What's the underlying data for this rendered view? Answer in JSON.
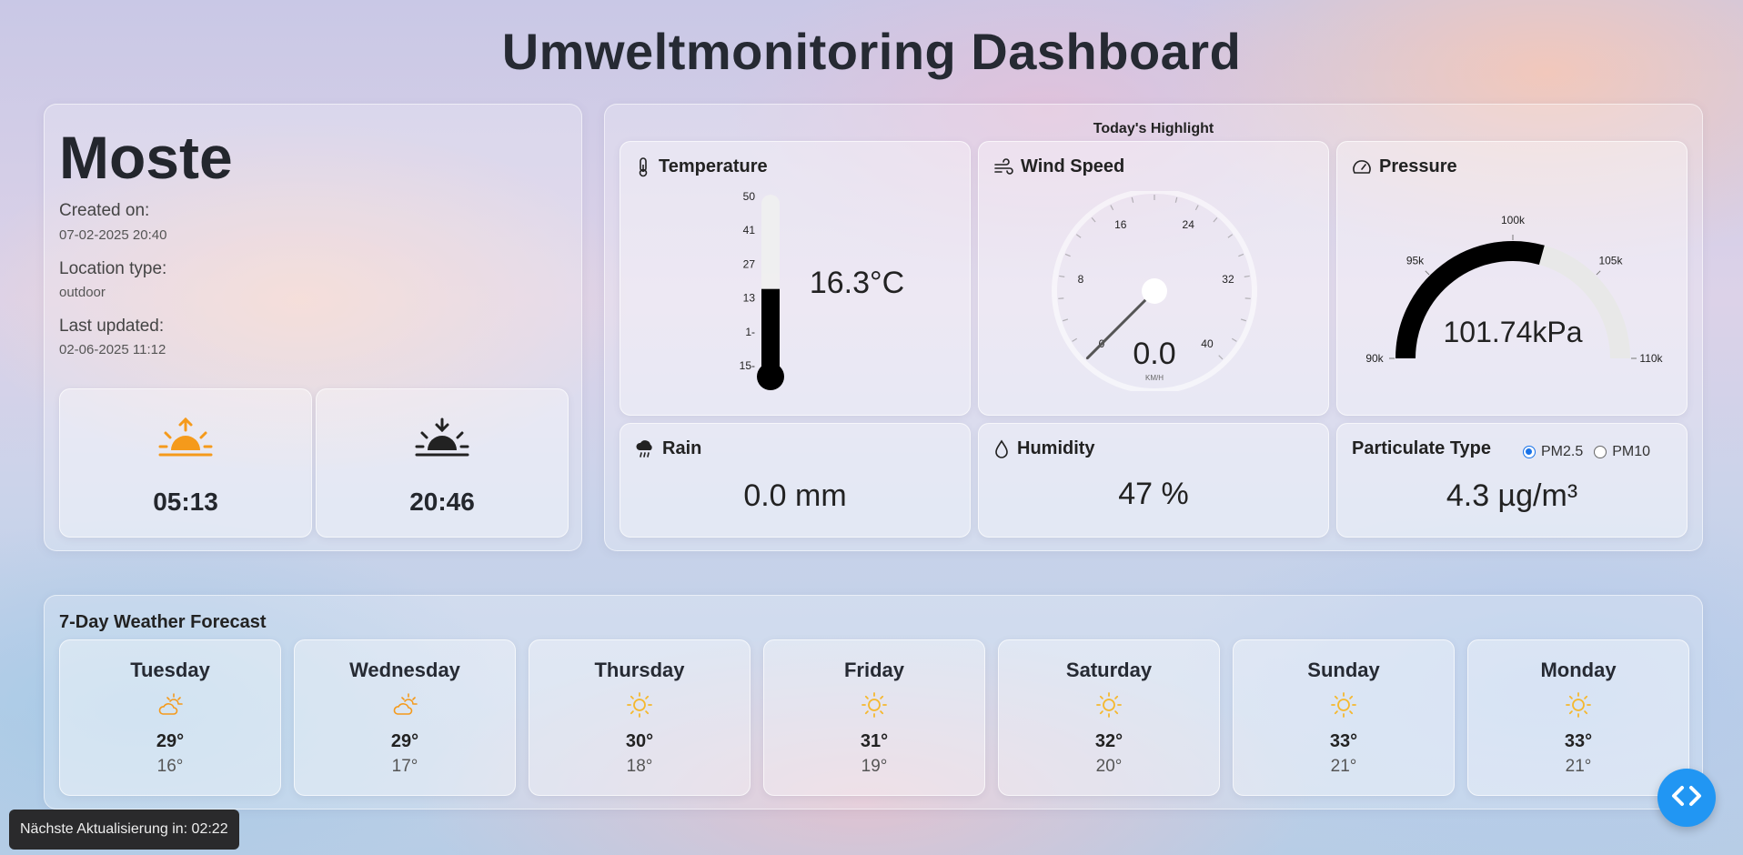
{
  "page": {
    "title": "Umweltmonitoring Dashboard"
  },
  "location": {
    "name": "Moste",
    "created_label": "Created on:",
    "created_value": "07-02-2025 20:40",
    "type_label": "Location type:",
    "type_value": "outdoor",
    "updated_label": "Last updated:",
    "updated_value": "02-06-2025 11:12",
    "sunrise": {
      "time": "05:13",
      "icon": "sunrise-icon",
      "color": "#f59a1b"
    },
    "sunset": {
      "time": "20:46",
      "icon": "sunset-icon",
      "color": "#222222"
    }
  },
  "highlight": {
    "title": "Today's Highlight",
    "temperature": {
      "label": "Temperature",
      "icon": "thermometer-icon",
      "value": "16.3°C",
      "reading": 16.3,
      "scale_labels": [
        "50",
        "41",
        "27",
        "13",
        "1-",
        "15-"
      ]
    },
    "wind": {
      "label": "Wind Speed",
      "icon": "wind-icon",
      "value": "0.0",
      "unit": "KM/H",
      "reading": 0.0,
      "tick_labels": [
        "0",
        "8",
        "16",
        "24",
        "32",
        "40"
      ]
    },
    "pressure": {
      "label": "Pressure",
      "icon": "gauge-icon",
      "value": "101.74kPa",
      "reading": 101.74,
      "tick_labels": [
        "90k",
        "95k",
        "100k",
        "105k",
        "110k"
      ]
    },
    "rain": {
      "label": "Rain",
      "icon": "rain-cloud-icon",
      "value": "0.0 mm"
    },
    "humidity": {
      "label": "Humidity",
      "icon": "droplet-icon",
      "value": "47 %"
    },
    "particulate": {
      "label": "Particulate Type",
      "options": [
        "PM2.5",
        "PM10"
      ],
      "selected": "PM2.5",
      "value": "4.3 µg/m³",
      "accent": "#1a73e8"
    }
  },
  "forecast": {
    "title": "7-Day Weather Forecast",
    "days": [
      {
        "day": "Tuesday",
        "icon": "partly-cloudy-icon",
        "high": "29°",
        "low": "16°"
      },
      {
        "day": "Wednesday",
        "icon": "partly-cloudy-icon",
        "high": "29°",
        "low": "17°"
      },
      {
        "day": "Thursday",
        "icon": "sun-icon",
        "high": "30°",
        "low": "18°"
      },
      {
        "day": "Friday",
        "icon": "sun-icon",
        "high": "31°",
        "low": "19°"
      },
      {
        "day": "Saturday",
        "icon": "sun-icon",
        "high": "32°",
        "low": "20°"
      },
      {
        "day": "Sunday",
        "icon": "sun-icon",
        "high": "33°",
        "low": "21°"
      },
      {
        "day": "Monday",
        "icon": "sun-icon",
        "high": "33°",
        "low": "21°"
      }
    ]
  },
  "status": {
    "countdown": "Nächste Aktualisierung in: 02:22"
  },
  "colors": {
    "fab": "#2196f3",
    "sun": "#f5b82e",
    "sunrise": "#f59a1b"
  }
}
